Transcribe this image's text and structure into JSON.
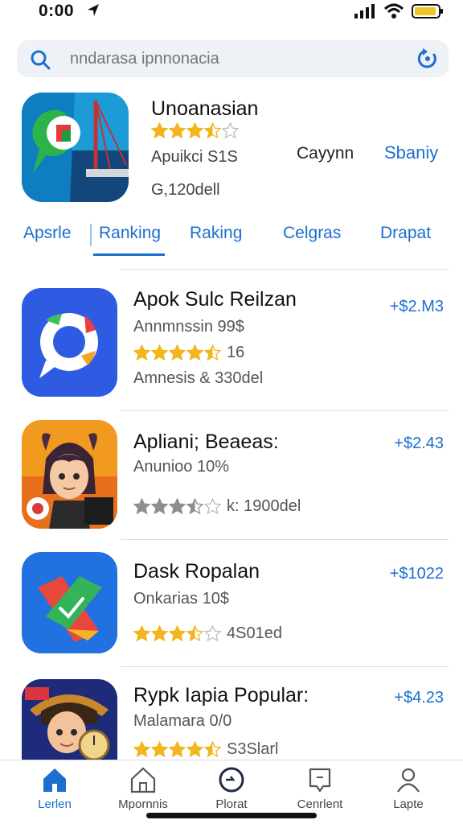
{
  "status_bar": {
    "time": "0:00"
  },
  "search": {
    "placeholder": "nndarasa ipnnonacia"
  },
  "featured": {
    "title": "Unoanasian",
    "rating": 3.5,
    "subtitle": "Apuikci S1S",
    "size": "G,120dell",
    "category": "Cayynn",
    "action": "Sbaniy"
  },
  "tabs": [
    "Apsrle",
    "Ranking",
    "Raking",
    "Celgras",
    "Drapat"
  ],
  "active_tab": 1,
  "apps": [
    {
      "title": "Apok Sulc Reilzan",
      "subtitle": "Annmnssin 99$",
      "rating": 4.5,
      "rating_text": "16",
      "meta": "Amnesis & 330del",
      "price": "+$2.M3"
    },
    {
      "title": "Apliani; Beaeas:",
      "subtitle": "Anunioo 10%",
      "rating": 3.5,
      "rating_text": "k: 1900del",
      "meta": "",
      "price": "+$2.43"
    },
    {
      "title": "Dask Ropalan",
      "subtitle": "Onkarias 10$",
      "rating": 3.5,
      "rating_text": "4S01ed",
      "meta": "",
      "price": "+$1022"
    },
    {
      "title": "Rypk Iapia Popular:",
      "subtitle": "Malamara 0/0",
      "rating": 4.5,
      "rating_text": "S3Slarl",
      "meta": "",
      "price": "+$4.23"
    }
  ],
  "bottom_nav": [
    {
      "label": "Lerlen",
      "icon": "home-icon"
    },
    {
      "label": "Mpornnis",
      "icon": "store-icon"
    },
    {
      "label": "Plorat",
      "icon": "clock-icon"
    },
    {
      "label": "Cenrlent",
      "icon": "chat-icon"
    },
    {
      "label": "Lapte",
      "icon": "profile-icon"
    }
  ],
  "colors": {
    "accent": "#1a6fd1",
    "star": "#f2b51d",
    "star_empty": "#b9bcc0"
  }
}
